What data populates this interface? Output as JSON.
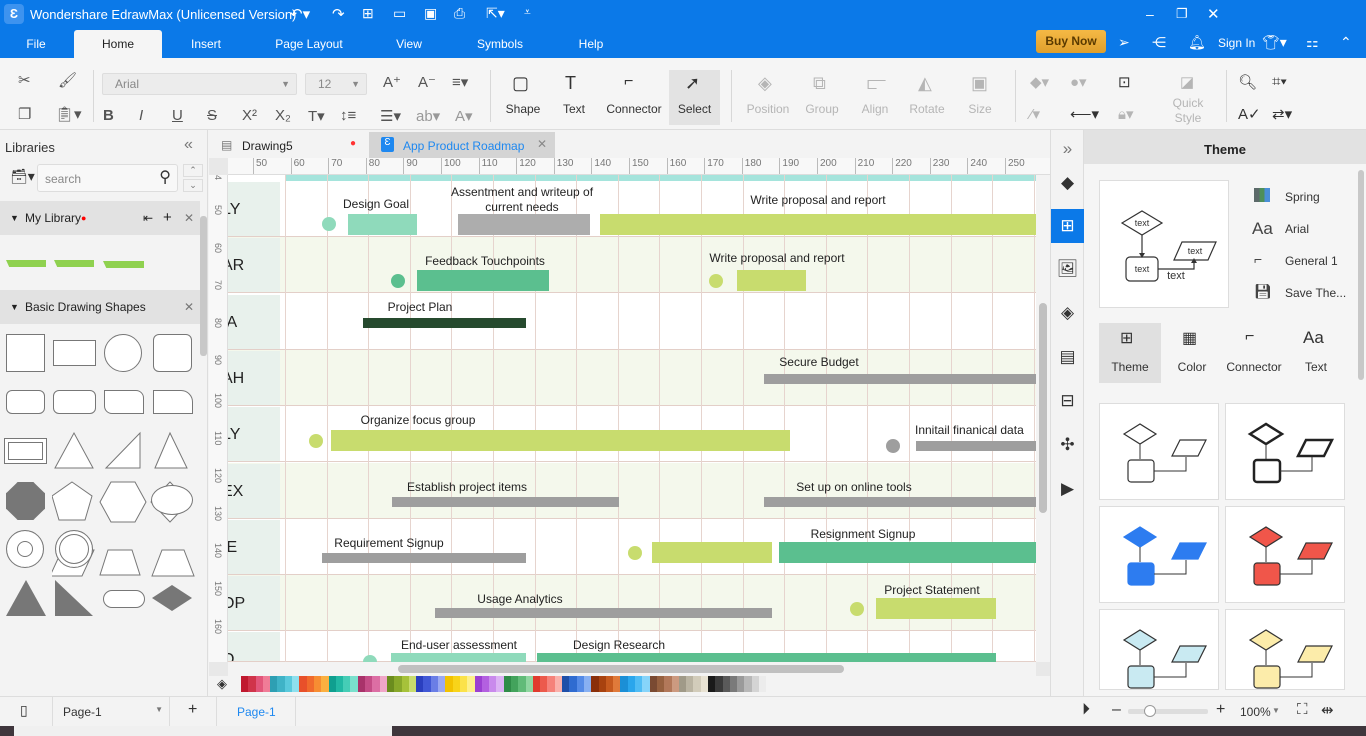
{
  "app": {
    "title": "Wondershare EdrawMax (Unlicensed Version)",
    "buy_now": "Buy Now",
    "sign_in": "Sign In"
  },
  "menu": [
    "File",
    "Home",
    "Insert",
    "Page Layout",
    "View",
    "Symbols",
    "Help"
  ],
  "toolbar": {
    "font": "Arial",
    "font_size": "12",
    "shape": "Shape",
    "text": "Text",
    "connector": "Connector",
    "select": "Select",
    "position": "Position",
    "group": "Group",
    "align": "Align",
    "rotate": "Rotate",
    "size": "Size",
    "quick_style_1": "Quick",
    "quick_style_2": "Style"
  },
  "libraries": {
    "title": "Libraries",
    "search_placeholder": "search",
    "my_library": "My Library",
    "basic_shapes": "Basic Drawing Shapes"
  },
  "tabs": [
    {
      "label": "Drawing5",
      "unsaved": true
    },
    {
      "label": "App Product Roadmap",
      "active": true
    }
  ],
  "ruler": {
    "h": [
      "50",
      "60",
      "70",
      "80",
      "90",
      "100",
      "110",
      "120",
      "130",
      "140",
      "150",
      "160",
      "170",
      "180",
      "190",
      "200",
      "210",
      "220",
      "230",
      "240",
      "250"
    ],
    "v": [
      "4",
      "50",
      "60",
      "70",
      "80",
      "90",
      "100",
      "110",
      "120",
      "130",
      "140",
      "150",
      "160"
    ]
  },
  "diagram": {
    "rows": [
      "LY",
      "AR",
      "IA",
      "AH",
      "LY",
      "EX",
      "IE",
      "OP",
      "O"
    ],
    "tasks": [
      "Design Goal",
      "Assentment and writeup of",
      "current needs",
      "Write proposal and report",
      "Feedback Touchpoints",
      "Write proposal and report",
      "Project Plan",
      "Secure Budget",
      "Organize focus group",
      "Innitail finanical data",
      "Establish project items",
      "Set up on online tools",
      "Requirement Signup",
      "Resignment Signup",
      "Usage Analytics",
      "Project Statement",
      "End-user assessment",
      "Design Research"
    ],
    "colors": {
      "teal": "#8fdabb",
      "green": "#5bbf8f",
      "lime": "#c8dc6e",
      "gray": "#9e9e9e",
      "dark": "#264a2e",
      "alt_row": "#f4f8ec"
    }
  },
  "theme_panel": {
    "title": "Theme",
    "options": [
      "Spring",
      "Arial",
      "General 1",
      "Save The..."
    ],
    "tabs": [
      "Theme",
      "Color",
      "Connector",
      "Text"
    ],
    "preview_text": "text"
  },
  "status": {
    "page_select": "Page-1",
    "page_tab": "Page-1",
    "zoom": "100%"
  },
  "palette": [
    "#c0192f",
    "#d0344a",
    "#e2567a",
    "#f07c97",
    "#2e9fb3",
    "#3fb3c7",
    "#59c9dc",
    "#8ee0ee",
    "#e8502a",
    "#f06a2c",
    "#f78d32",
    "#fbb040",
    "#0f9f8f",
    "#21b8a3",
    "#45cdb6",
    "#7ae0cd",
    "#a8326a",
    "#c44c86",
    "#dc6ea4",
    "#f0a6c8",
    "#6b8c1e",
    "#88a82a",
    "#a6c23a",
    "#c8dc6e",
    "#2a3fbf",
    "#4158d6",
    "#6a7ee6",
    "#9aa8f2",
    "#f2c200",
    "#f8d41a",
    "#fbe24a",
    "#fdf08a",
    "#9b3fd1",
    "#b360e0",
    "#c98aec",
    "#dcb2f4",
    "#2f8c48",
    "#43a35c",
    "#61bb78",
    "#8fd6a0",
    "#e03a2e",
    "#ec5a4c",
    "#f5827a",
    "#fab0aa",
    "#1e4fa8",
    "#2f6bd0",
    "#548ae6",
    "#88b0f2",
    "#8a2f0a",
    "#a8420f",
    "#c65a1e",
    "#e07a3a",
    "#1b8fd6",
    "#2aa6ec",
    "#4fbcf4",
    "#86d4fa",
    "#7a4a32",
    "#96603f",
    "#b2785a",
    "#cc9a80",
    "#a09a88",
    "#bab4a2",
    "#d2ccba",
    "#e8e2d2",
    "#1a1a1a",
    "#3a3a3a",
    "#5a5a5a",
    "#7a7a7a",
    "#9a9a9a",
    "#b8b8b8",
    "#d4d4d4",
    "#ececec"
  ]
}
